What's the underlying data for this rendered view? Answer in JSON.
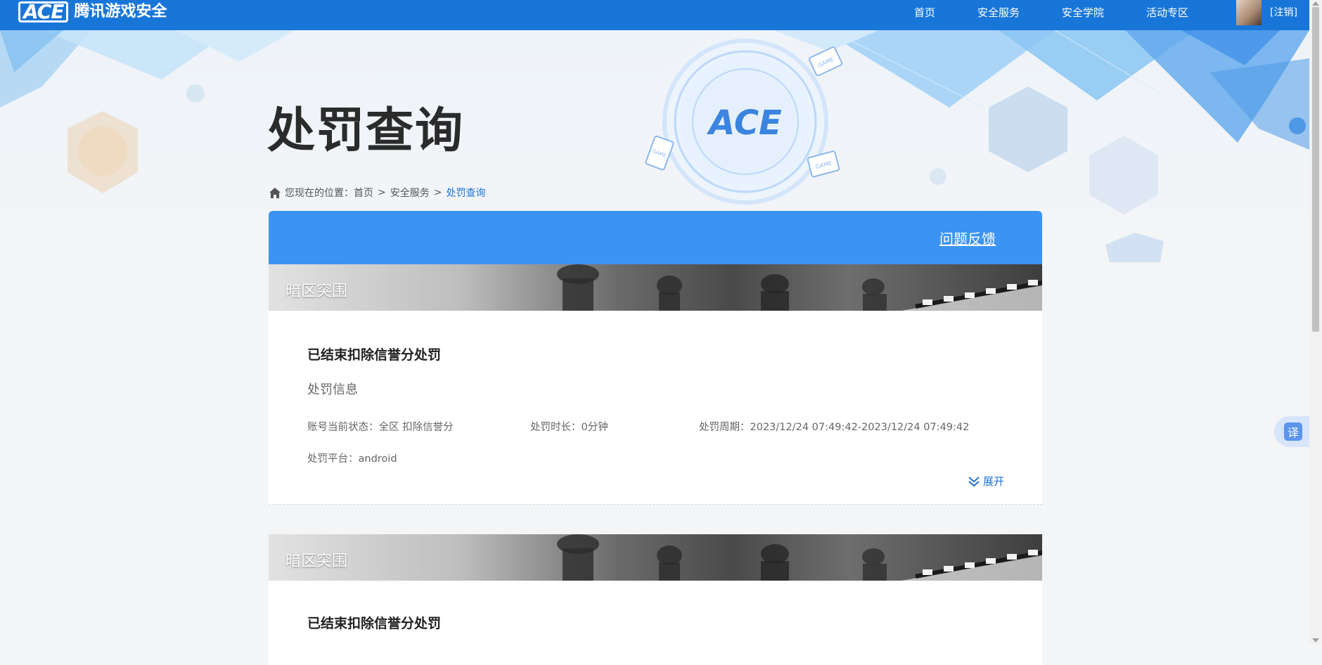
{
  "header": {
    "logo_mark": "ACE",
    "logo_text": "腾讯游戏安全",
    "nav": [
      {
        "label": "首页"
      },
      {
        "label": "安全服务"
      },
      {
        "label": "安全学院"
      },
      {
        "label": "活动专区"
      }
    ],
    "logout_label": "[注销]"
  },
  "hero": {
    "title": "处罚查询",
    "emblem_text": "ACE",
    "game_tags": [
      "GAME",
      "GAME",
      "GAME"
    ]
  },
  "breadcrumb": {
    "prefix": "您现在的位置：",
    "items": [
      "首页",
      "安全服务"
    ],
    "current": "处罚查询",
    "separator": ">"
  },
  "panel": {
    "feedback_label": "问题反馈",
    "records": [
      {
        "game": "暗区突围",
        "title": "已结束扣除信誉分处罚",
        "section": "处罚信息",
        "status": "账号当前状态：全区 扣除信誉分",
        "duration": "处罚时长：0分钟",
        "period": "处罚周期：2023/12/24 07:49:42-2023/12/24 07:49:42",
        "platform": "处罚平台：android",
        "expand_label": "展开"
      },
      {
        "game": "暗区突围",
        "title": "已结束扣除信誉分处罚"
      }
    ]
  },
  "translate_label": "译",
  "colors": {
    "nav_bg": "#1976d9",
    "panel_head": "#3b94f3",
    "link_blue": "#1d73d3"
  }
}
